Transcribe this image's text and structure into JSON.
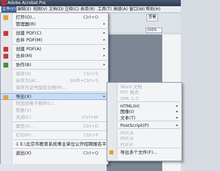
{
  "window": {
    "title": "Adobe Acrobat Pro"
  },
  "menubar": [
    {
      "label": "文件(F)",
      "active": true
    },
    {
      "label": "编辑(E)"
    },
    {
      "label": "视图(V)"
    },
    {
      "label": "文档(D)"
    },
    {
      "label": "注释(C)"
    },
    {
      "label": "表单(R)"
    },
    {
      "label": "工具(T)"
    },
    {
      "label": "高级(A)"
    },
    {
      "label": "窗口(W)"
    },
    {
      "label": "帮助(H)"
    }
  ],
  "toolbar": {
    "sign_label": "签署",
    "zoom": "100%"
  },
  "file_menu": [
    {
      "label": "打开(O)...",
      "shortcut": "Ctrl+O",
      "icon_color": "#e2a23b"
    },
    {
      "label": "管理器(R)",
      "arrow": "▸"
    },
    {
      "sep": true
    },
    {
      "label": "创建 PDF(C)",
      "arrow": "▸",
      "icon_color": "#c63a3a"
    },
    {
      "label": "合并 PDF(M)",
      "arrow": "▸"
    },
    {
      "sep": true
    },
    {
      "label": "创建 PDF(A)",
      "arrow": "▸",
      "icon_color": "#c63a3a"
    },
    {
      "label": "合并(M)",
      "arrow": "▸",
      "icon_color": "#c63a3a"
    },
    {
      "sep": true
    },
    {
      "label": "协作(B)",
      "arrow": "▸",
      "icon_color": "#4a8a3a"
    },
    {
      "sep": true
    },
    {
      "label": "保存(S)",
      "shortcut": "Ctrl+S",
      "disabled": true
    },
    {
      "label": "另存为(A)...",
      "shortcut": "Shift+Ctrl+S",
      "disabled": true
    },
    {
      "label": "保存为证书加密文档(R)...",
      "disabled": true
    },
    {
      "sep": true
    },
    {
      "label": "导出(X)",
      "arrow": "▸",
      "highlighted": true,
      "icon_color": "#e2a23b"
    },
    {
      "label": "附加到电子邮件(L)...",
      "disabled": true
    },
    {
      "label": "恢复(V)",
      "disabled": true
    },
    {
      "label": "关闭(C)",
      "shortcut": "Ctrl+W",
      "disabled": true
    },
    {
      "sep": true
    },
    {
      "label": "属性(I)...",
      "shortcut": "Ctrl+D",
      "disabled": true
    },
    {
      "sep": true
    },
    {
      "label": "打印(P)...",
      "shortcut": "Ctrl+P",
      "disabled": true
    },
    {
      "sep": true
    },
    {
      "label": "1 E:\\北京市教育系统事业单位公开招聘报名平台.pdf"
    },
    {
      "sep": true
    },
    {
      "label": "退出(X)",
      "shortcut": "Ctrl+Q"
    }
  ],
  "export_submenu": [
    {
      "label": "Word 文档",
      "disabled": true
    },
    {
      "label": "RTF 格式",
      "disabled": true
    },
    {
      "label": "XML 1.0",
      "disabled": true
    },
    {
      "sep": true
    },
    {
      "label": "HTML(H)",
      "arrow": "▸"
    },
    {
      "label": "图像(I)",
      "arrow": "▸"
    },
    {
      "label": "文本(T)",
      "arrow": "▸"
    },
    {
      "sep": true
    },
    {
      "label": "PostScript(P)",
      "arrow": "▸"
    },
    {
      "sep": true
    },
    {
      "label": "PDF/A",
      "disabled": true
    },
    {
      "label": "PDF/X",
      "disabled": true
    },
    {
      "label": "PDF/E",
      "disabled": true
    },
    {
      "sep": true
    },
    {
      "label": "导出多个文件(F)...",
      "icon": true
    }
  ]
}
